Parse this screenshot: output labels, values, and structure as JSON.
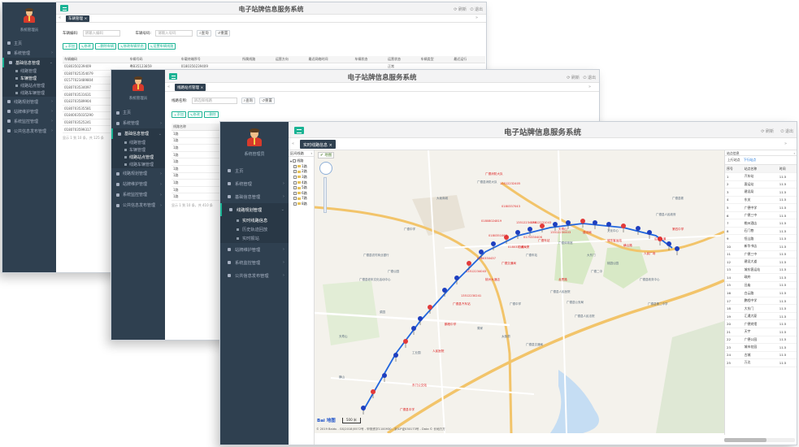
{
  "app": {
    "title": "电子站牌信息服务系统",
    "user": "系统管理员",
    "right_refresh": "刷新",
    "right_logout": "退出",
    "tab_close": "×"
  },
  "menu": {
    "home": "主页",
    "system": "系统管理",
    "basic": "基础信息管理",
    "route": "线路规划管理",
    "station": "站牌维护管理",
    "sysmon": "系统监控管理",
    "publish": "公共信息发布管理",
    "basic_sub": [
      "线路管理",
      "车辆管理",
      "线路站点管理",
      "线路车辆管理"
    ],
    "route_sub": [
      "实时线路信息",
      "历史轨迹回放",
      "实时报站"
    ]
  },
  "w1": {
    "tab": "车辆管理",
    "form": {
      "l1": "车辆编码:",
      "p1": "请输入编码",
      "l2": "车辆号码:",
      "p2": "请输入号码",
      "search": "查询",
      "reset": "重置"
    },
    "toolbar": [
      "添加",
      "修改",
      "删除车辆",
      "修改车辆状态",
      "设置车辆线路"
    ],
    "headers": [
      "车辆编码",
      "车辆号码",
      "车载终端序号",
      "所属线路",
      "运营方向",
      "最近网络时间",
      "车辆状态",
      "运营状态",
      "车辆类型",
      "最近运行"
    ],
    "rows": [
      [
        "0180350239409",
        "粤B35123859",
        "0180350239409",
        "",
        "",
        "",
        "",
        "正常",
        "",
        "",
        ""
      ],
      [
        "01807025354079",
        "",
        "",
        "",
        "",
        "",
        "",
        "",
        "",
        "",
        ""
      ],
      [
        "01577023489804",
        "",
        "",
        "",
        "",
        "",
        "",
        "",
        "",
        "",
        ""
      ],
      [
        "0180703534097",
        "",
        "",
        "",
        "",
        "",
        "",
        "",
        "",
        "",
        ""
      ],
      [
        "0180703531631",
        "",
        "",
        "",
        "",
        "",
        "",
        "",
        "",
        "",
        ""
      ],
      [
        "0183703589904",
        "",
        "",
        "",
        "",
        "",
        "",
        "",
        "",
        "",
        ""
      ],
      [
        "0180703535581",
        "",
        "",
        "",
        "",
        "",
        "",
        "",
        "",
        "",
        ""
      ],
      [
        "01840035035290",
        "",
        "",
        "",
        "",
        "",
        "",
        "",
        "",
        "",
        ""
      ],
      [
        "0180703525241",
        "",
        "",
        "",
        "",
        "",
        "",
        "",
        "",
        "",
        ""
      ],
      [
        "0180703599317",
        "",
        "",
        "",
        "",
        "",
        "",
        "",
        "",
        "",
        ""
      ]
    ],
    "pager": "显示 1 到 10 条，共 125 条"
  },
  "w2": {
    "tab": "线路站点管理",
    "form": {
      "l1": "线路名称:",
      "p1": "请选择线路",
      "search": "查询",
      "reset": "重置"
    },
    "toolbar": [
      "添加",
      "修改",
      "删除"
    ],
    "headers": [
      "线路名称"
    ],
    "rows": [
      "1路",
      "1路",
      "1路",
      "1路",
      "1路",
      "1路",
      "1路",
      "1路",
      "1路",
      "1路"
    ],
    "pager": "显示 1 到 10 条，共 410 条"
  },
  "w3": {
    "tab": "实时线路信息",
    "tree": {
      "header": "区间线路",
      "root": "线路",
      "routes": [
        "1路",
        "2路",
        "3路",
        "4路",
        "5路",
        "6路",
        "7路",
        "8路"
      ]
    },
    "map": {
      "copyright": "© 2019 Baidu - GS(2018)5572号 - 甲测资字1100930 - 京ICP证030173号 - Data © 长地万方",
      "scale": "500 米",
      "logo": "Bai 地图",
      "places": [
        "广德县消防大队",
        "大坂商城",
        "广德中学",
        "广德县人民医院",
        "广德县公安局",
        "广德县人民法院",
        "广德县委",
        "广德中学",
        "桃园公园",
        "广德县农村商业银行",
        "广德县老年文化活动中心",
        "广德公园",
        "广德县政务中心",
        "广德县人民政府",
        "天寿山",
        "横山",
        "广德县交通局",
        "广德体育馆",
        "大东门",
        "文化中心",
        "广德二中",
        "广德车站",
        "周家",
        "太极洞",
        "菜园",
        "工业园",
        "广德县第二中学"
      ],
      "bus_labels": [
        "13512232405",
        "01808024819",
        "0180351063",
        "0180335402",
        "13512234056",
        "0175330406",
        "13512231043",
        "0180337043",
        "13512230403",
        "0180330437",
        "13512234043",
        "13512230241"
      ],
      "red_labels": [
        "广德消防大队",
        "广德县中学",
        "东门公交站",
        "人民医院",
        "鹏程中学",
        "广德县汽车站",
        "桃州大酒店",
        "广德交通局",
        "汇通大厦",
        "广德车站",
        "天寿山",
        "建设局",
        "城东客运站",
        "横山路",
        "人民广场",
        "沿河大道",
        "第四中学",
        "龙恩路"
      ]
    },
    "panel": {
      "title": "站点信息",
      "tabs": [
        "上行站点",
        "下行站点"
      ],
      "headers": [
        "序号",
        "站点名称",
        "时间"
      ],
      "stations": [
        "汽车站",
        "客运站",
        "建设局",
        "东关",
        "广德中学",
        "广德三中",
        "桃州酒店",
        "石门巷",
        "恒山路",
        "新华书店",
        "广德三中",
        "建设大道",
        "城东客运站",
        "政府",
        "吕庙",
        "白云路",
        "鹏程中学",
        "大东门",
        "汇通大厦",
        "广德宾馆",
        "天宇",
        "广德公园",
        "城市花园",
        "古城",
        "万达"
      ],
      "times": [
        "11.5",
        "11.5",
        "11.5",
        "11.5",
        "11.5",
        "11.5",
        "11.5",
        "11.5",
        "11.5",
        "11.5",
        "11.5",
        "11.5",
        "11.5",
        "11.5",
        "11.5",
        "11.5",
        "11.5",
        "11.5",
        "11.5",
        "11.5",
        "11.5",
        "11.5",
        "11.5",
        "11.5",
        "11.5"
      ]
    }
  }
}
